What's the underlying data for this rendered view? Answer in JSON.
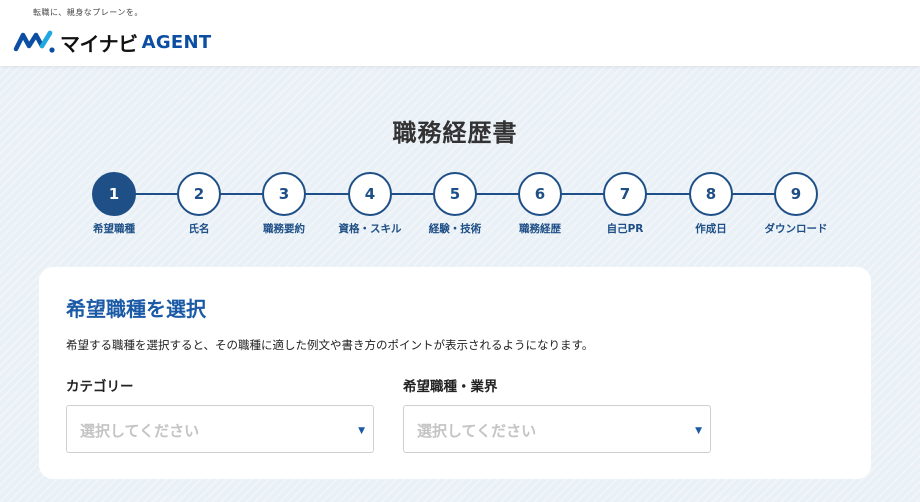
{
  "header": {
    "tagline": "転職に、親身なプレーンを。",
    "logo_text": "マイナビ",
    "logo_agent": "AGENT",
    "brand_color": "#0b4ea2",
    "accent_color": "#1fa9e1"
  },
  "page": {
    "title": "職務経歴書"
  },
  "stepper": {
    "active_step": 1,
    "steps": [
      {
        "number": "1",
        "label": "希望職種"
      },
      {
        "number": "2",
        "label": "氏名"
      },
      {
        "number": "3",
        "label": "職務要約"
      },
      {
        "number": "4",
        "label": "資格・スキル"
      },
      {
        "number": "5",
        "label": "経験・技術"
      },
      {
        "number": "6",
        "label": "職務経歴"
      },
      {
        "number": "7",
        "label": "自己PR"
      },
      {
        "number": "8",
        "label": "作成日"
      },
      {
        "number": "9",
        "label": "ダウンロード"
      }
    ],
    "color": "#1e4f86"
  },
  "form": {
    "title": "希望職種を選択",
    "description": "希望する職種を選択すると、その職種に適した例文や書き方のポイントが表示されるようになります。",
    "category": {
      "label": "カテゴリー",
      "placeholder": "選択してください",
      "arrow_icon": "caret-down-icon"
    },
    "job_type": {
      "label": "希望職種・業界",
      "placeholder": "選択してください",
      "arrow_icon": "caret-down-icon"
    }
  }
}
